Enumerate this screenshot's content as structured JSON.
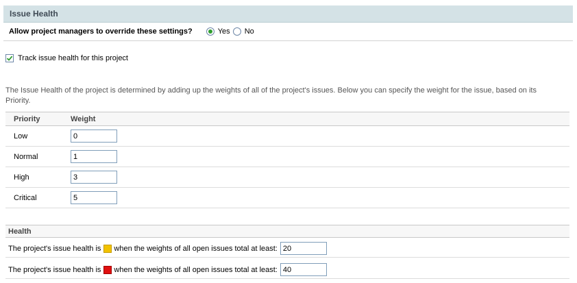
{
  "panel": {
    "title": "Issue Health"
  },
  "override": {
    "question": "Allow project managers to override these settings?",
    "yes_label": "Yes",
    "no_label": "No",
    "selected": "Yes"
  },
  "track": {
    "label": "Track issue health for this project",
    "checked": true
  },
  "description": "The Issue Health of the project is determined by adding up the weights of all of the project's issues. Below you can specify the weight for the issue, based on its Priority.",
  "priority_table": {
    "headers": [
      "Priority",
      "Weight"
    ],
    "rows": [
      {
        "priority": "Low",
        "weight": "0"
      },
      {
        "priority": "Normal",
        "weight": "1"
      },
      {
        "priority": "High",
        "weight": "3"
      },
      {
        "priority": "Critical",
        "weight": "5"
      }
    ]
  },
  "health": {
    "header": "Health",
    "prefix": "The project's issue health is",
    "suffix": "when the weights of all open issues total at least:",
    "thresholds": [
      {
        "status_icon": "yellow-square-icon",
        "color": "#f2c200",
        "value": "20"
      },
      {
        "status_icon": "red-square-icon",
        "color": "#e01010",
        "value": "40"
      }
    ]
  },
  "colors": {
    "header_bg": "#d4e2e6",
    "radio_selected": "#2f9d2f",
    "checkbox_check": "#2f9d2f"
  }
}
